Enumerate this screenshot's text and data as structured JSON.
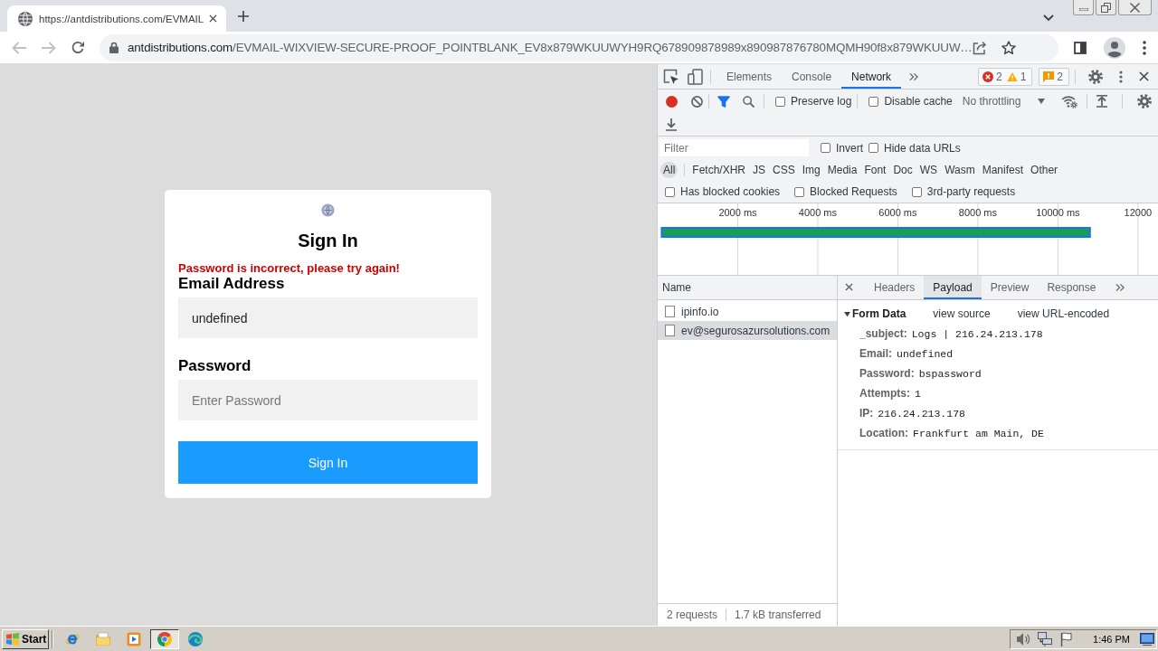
{
  "browser": {
    "tab": {
      "title": "https://antdistributions.com/EVMAIL"
    },
    "address": {
      "host": "antdistributions.com",
      "path": "/EVMAIL-WIXVIEW-SECURE-PROOF_POINTBLANK_EV8x879WKUUWYH9RQ678909878989x890987876780MQMH90f8x879WKUUW…"
    }
  },
  "page": {
    "title": "Sign In",
    "error": "Password is incorrect, please try again!",
    "fields": [
      {
        "label": "Email Address",
        "value": "undefined"
      },
      {
        "label": "Password",
        "placeholder": "Enter Password"
      }
    ],
    "button": "Sign In"
  },
  "devtools": {
    "tabs": [
      {
        "label": "Elements",
        "selected": false
      },
      {
        "label": "Console",
        "selected": false
      },
      {
        "label": "Network",
        "selected": true
      }
    ],
    "counts": {
      "errors": "2",
      "warnings": "1",
      "issues": "2"
    },
    "toolbar": {
      "recording": true,
      "filter_active": true,
      "options": [
        {
          "label": "Preserve log",
          "checked": false
        },
        {
          "label": "Disable cache",
          "checked": false
        }
      ],
      "throttling": "No throttling"
    },
    "filter": {
      "placeholder": "Filter",
      "options": [
        {
          "label": "Invert",
          "checked": false
        },
        {
          "label": "Hide data URLs",
          "checked": false
        }
      ]
    },
    "types": [
      {
        "label": "All",
        "selected": true
      },
      {
        "label": "Fetch/XHR",
        "selected": false
      },
      {
        "label": "JS",
        "selected": false
      },
      {
        "label": "CSS",
        "selected": false
      },
      {
        "label": "Img",
        "selected": false
      },
      {
        "label": "Media",
        "selected": false
      },
      {
        "label": "Font",
        "selected": false
      },
      {
        "label": "Doc",
        "selected": false
      },
      {
        "label": "WS",
        "selected": false
      },
      {
        "label": "Wasm",
        "selected": false
      },
      {
        "label": "Manifest",
        "selected": false
      },
      {
        "label": "Other",
        "selected": false
      }
    ],
    "blocked_options": [
      {
        "label": "Has blocked cookies",
        "checked": false
      },
      {
        "label": "Blocked Requests",
        "checked": false
      },
      {
        "label": "3rd-party requests",
        "checked": false
      }
    ],
    "overview": {
      "chart_data": {
        "type": "bar",
        "orientation": "horizontal",
        "categories": [
          null
        ],
        "base": [
          100
        ],
        "values": [
          10700
        ],
        "color": "#1a9e55",
        "xlim": [
          0,
          12500
        ],
        "xticks": [
          {
            "value": 2000,
            "label": "2000 ms"
          },
          {
            "value": 4000,
            "label": "4000 ms"
          },
          {
            "value": 6000,
            "label": "6000 ms"
          },
          {
            "value": 8000,
            "label": "8000 ms"
          },
          {
            "value": 10000,
            "label": "10000 ms"
          },
          {
            "value": 12000,
            "label": "12000"
          }
        ],
        "grid": true
      }
    },
    "requests": {
      "column": "Name",
      "rows": [
        {
          "name": "ipinfo.io",
          "selected": false
        },
        {
          "name": "ev@segurosazursolutions.com",
          "selected": true
        }
      ]
    },
    "detail": {
      "tabs": [
        {
          "label": "Headers",
          "selected": false
        },
        {
          "label": "Payload",
          "selected": true
        },
        {
          "label": "Preview",
          "selected": false
        },
        {
          "label": "Response",
          "selected": false
        }
      ],
      "section": {
        "title": "Form Data",
        "expanded": true,
        "links": [
          "view source",
          "view URL-encoded"
        ],
        "fields": [
          {
            "key": "_subject:",
            "value": "Logs | 216.24.213.178"
          },
          {
            "key": "Email:",
            "value": "undefined"
          },
          {
            "key": "Password:",
            "value": "bspassword"
          },
          {
            "key": "Attempts:",
            "value": "1"
          },
          {
            "key": "IP:",
            "value": "216.24.213.178"
          },
          {
            "key": "Location:",
            "value": "Frankfurt am Main, DE"
          }
        ]
      }
    },
    "status": [
      "2 requests",
      "1.7 kB transferred"
    ]
  },
  "taskbar": {
    "start": "Start",
    "pinned": [
      {
        "selected": false
      },
      {
        "selected": false
      },
      {
        "selected": false
      },
      {
        "selected": true
      },
      {
        "selected": false
      }
    ],
    "clock": "1:46 PM"
  }
}
